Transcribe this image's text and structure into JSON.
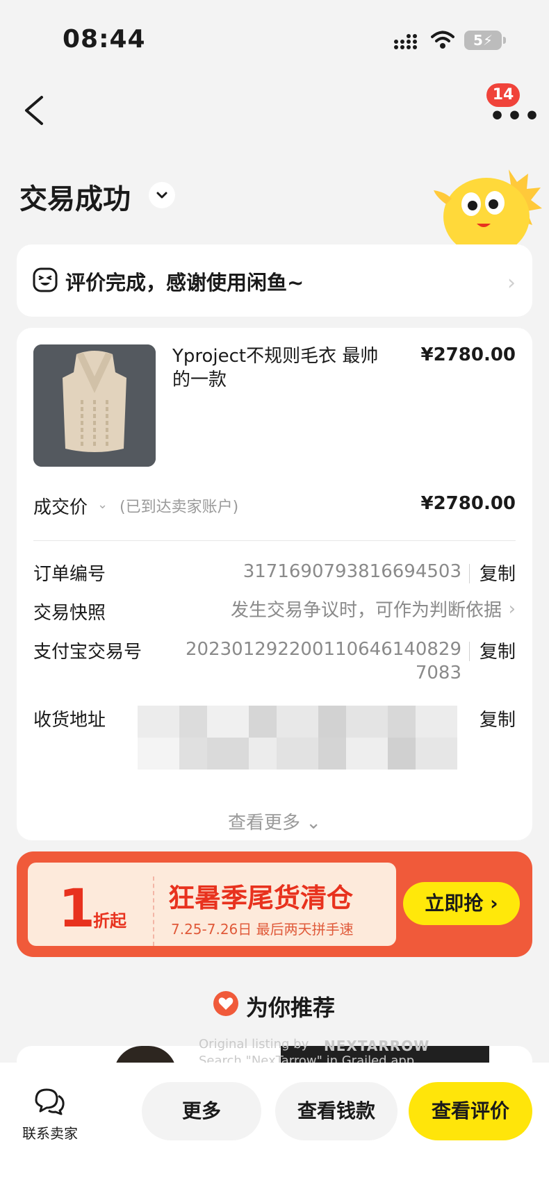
{
  "status_bar": {
    "time": "08:44",
    "battery": "5"
  },
  "header": {
    "badge_count": "14"
  },
  "order_status": {
    "title": "交易成功"
  },
  "notice": {
    "text": "评价完成，感谢使用闲鱼~"
  },
  "product": {
    "title": "Yproject不规则毛衣 最帅的一款",
    "price": "¥2780.00"
  },
  "deal": {
    "label": "成交价",
    "note": "(已到达卖家账户)",
    "price": "¥2780.00"
  },
  "order_info": {
    "order_no": {
      "label": "订单编号",
      "value": "3171690793816694503",
      "action": "复制"
    },
    "snapshot": {
      "label": "交易快照",
      "value": "发生交易争议时，可作为判断依据"
    },
    "alipay_no": {
      "label": "支付宝交易号",
      "value_line1": "202301292200110646140829",
      "value_line2": "7083",
      "action": "复制"
    },
    "address": {
      "label": "收货地址",
      "action": "复制"
    }
  },
  "view_more": "查看更多",
  "promo": {
    "big_number": "1",
    "unit": "折起",
    "title": "狂暑季尾货清仓",
    "subtitle": "7.25-7.26日 最后两天拼手速",
    "button": "立即抢"
  },
  "recommend": {
    "title": "为你推荐"
  },
  "watermark": {
    "line1": "Original listing by",
    "brand": "NEXTARROW",
    "line2": "Search \"NexTarrow\" in Grailed app."
  },
  "bottom_bar": {
    "contact": "联系卖家",
    "more": "更多",
    "view_payment": "查看钱款",
    "view_review": "查看评价"
  },
  "colors": {
    "accent_yellow": "#ffe50a",
    "promo_red": "#e8321e",
    "badge_red": "#f0433a"
  }
}
